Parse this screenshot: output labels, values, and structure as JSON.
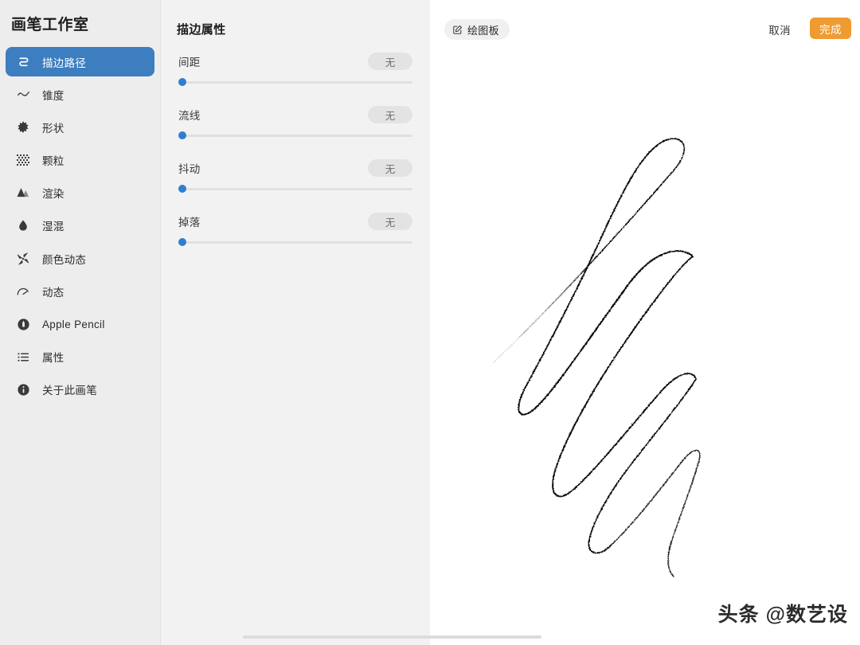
{
  "sidebar": {
    "title": "画笔工作室",
    "items": [
      {
        "label": "描边路径",
        "icon": "stroke-path-icon",
        "selected": true
      },
      {
        "label": "锥度",
        "icon": "taper-wave-icon",
        "selected": false
      },
      {
        "label": "形状",
        "icon": "shape-starburst-icon",
        "selected": false
      },
      {
        "label": "颗粒",
        "icon": "grain-texture-icon",
        "selected": false
      },
      {
        "label": "渲染",
        "icon": "rendering-mountains-icon",
        "selected": false
      },
      {
        "label": "湿混",
        "icon": "wet-mix-droplet-icon",
        "selected": false
      },
      {
        "label": "颜色动态",
        "icon": "color-dynamics-pinwheel-icon",
        "selected": false
      },
      {
        "label": "动态",
        "icon": "dynamics-gauge-icon",
        "selected": false
      },
      {
        "label": "Apple Pencil",
        "icon": "apple-pencil-icon",
        "selected": false
      },
      {
        "label": "属性",
        "icon": "attributes-list-icon",
        "selected": false
      },
      {
        "label": "关于此画笔",
        "icon": "about-info-icon",
        "selected": false
      }
    ]
  },
  "properties": {
    "title": "描边属性",
    "sliders": [
      {
        "label": "间距",
        "value": "无",
        "percent": 0
      },
      {
        "label": "流线",
        "value": "无",
        "percent": 0
      },
      {
        "label": "抖动",
        "value": "无",
        "percent": 0
      },
      {
        "label": "掉落",
        "value": "无",
        "percent": 0
      }
    ]
  },
  "canvas": {
    "drawing_board_chip": {
      "label": "绘图板",
      "icon": "pencil-square-icon"
    },
    "cancel_label": "取消",
    "done_label": "完成",
    "watermark": "头条 @数艺设"
  },
  "colors": {
    "accent_blue": "#3c7ec0",
    "slider_blue": "#2f7ed1",
    "done_orange": "#ef9b32",
    "sidebar_bg": "#ededed",
    "panel_bg": "#f2f2f2",
    "canvas_bg": "#ffffff"
  }
}
